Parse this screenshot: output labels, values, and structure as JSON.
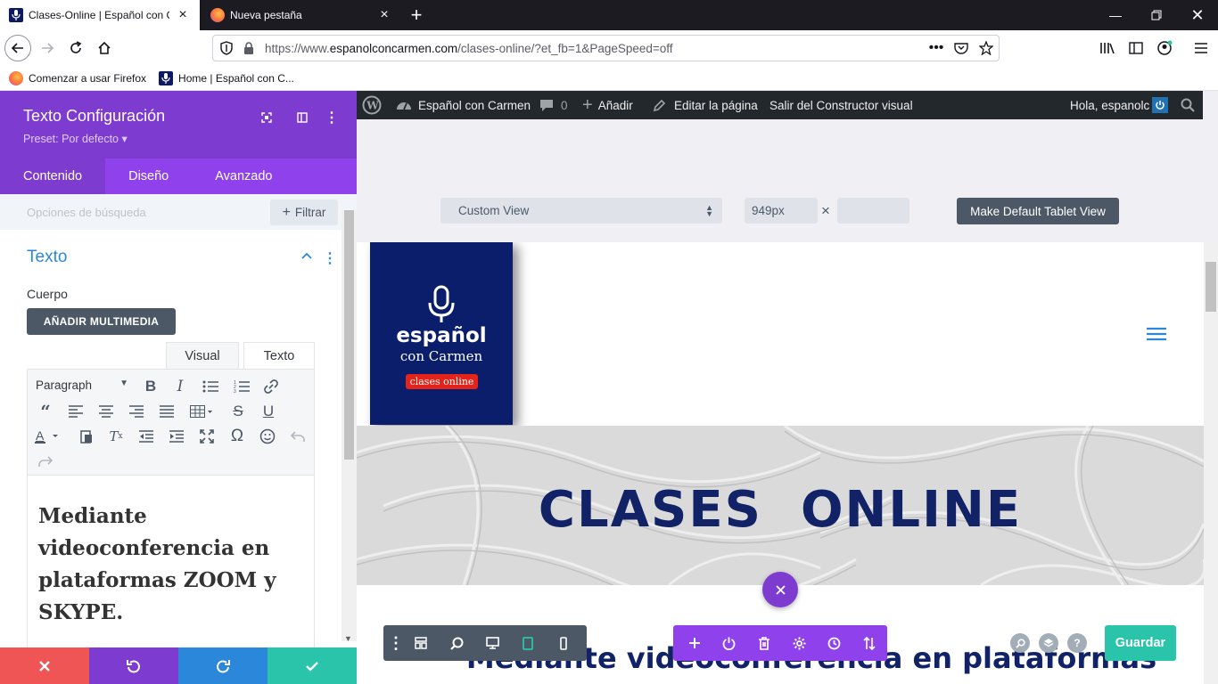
{
  "browser": {
    "tabs": [
      {
        "label": "Clases-Online | Español con Ca",
        "active": true
      },
      {
        "label": "Nueva pestaña",
        "active": false
      }
    ],
    "url_prefix": "https://www.",
    "url_domain": "espanolconcarmen.com",
    "url_path": "/clases-online/?et_fb=1&PageSpeed=off",
    "bookmarks": [
      "Comenzar a usar Firefox",
      "Home | Español con C..."
    ]
  },
  "panel": {
    "title": "Texto Configuración",
    "preset": "Preset: Por defecto",
    "tabs": [
      "Contenido",
      "Diseño",
      "Avanzado"
    ],
    "search_placeholder": "Opciones de búsqueda",
    "filter_label": "Filtrar",
    "section_title": "Texto",
    "body_label": "Cuerpo",
    "add_media_label": "AÑADIR MULTIMEDIA",
    "editor_tabs": [
      "Visual",
      "Texto"
    ],
    "format_select": "Paragraph",
    "editor_content": "Mediante videoconferencia en plataformas ZOOM y SKYPE."
  },
  "wp_admin_bar": {
    "site_name": "Español con Carmen",
    "comments_count": "0",
    "add_label": "Añadir",
    "edit_label": "Editar la página",
    "exit_label": "Salir del Constructor visual",
    "greeting": "Hola, espanolc"
  },
  "view_controls": {
    "view_mode": "Custom View",
    "width_value": "949px",
    "times": "×",
    "make_default_label": "Make Default Tablet View"
  },
  "site": {
    "logo_title": "español",
    "logo_sub": "con Carmen",
    "logo_badge": "clases online",
    "hero_title": "CLASES  ONLINE",
    "subtitle": "Mediante videoconferencia en plataformas"
  },
  "builder": {
    "save_label": "Guardar",
    "help_label": "?"
  },
  "colors": {
    "divi_purple": "#7e3bd0",
    "divi_purple_light": "#8f42ec",
    "divi_blue": "#2b87da",
    "save_green": "#29c4a9",
    "brand_navy": "#0a1e6b",
    "heading_navy": "#122266"
  }
}
